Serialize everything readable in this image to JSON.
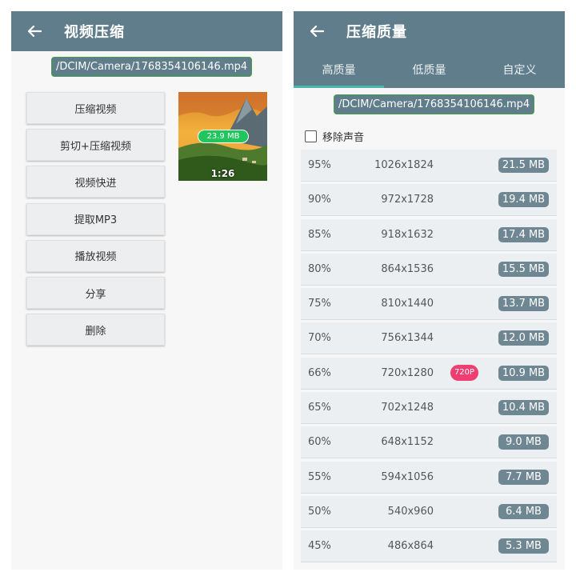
{
  "left": {
    "title": "视频压缩",
    "path": "/DCIM/Camera/1768354106146.mp4",
    "buttons": [
      "压缩视频",
      "剪切+压缩视频",
      "视频快进",
      "提取MP3",
      "播放视频",
      "分享",
      "删除"
    ],
    "thumbnail": {
      "size": "23.9 MB",
      "duration": "1:26"
    }
  },
  "right": {
    "title": "压缩质量",
    "tabs": [
      "高质量",
      "低质量",
      "自定义"
    ],
    "active_tab": 0,
    "path": "/DCIM/Camera/1768354106146.mp4",
    "remove_audio_label": "移除声音",
    "rows": [
      {
        "pct": "95%",
        "res": "1026x1824",
        "size": "21.5 MB"
      },
      {
        "pct": "90%",
        "res": "972x1728",
        "size": "19.4 MB"
      },
      {
        "pct": "85%",
        "res": "918x1632",
        "size": "17.4 MB"
      },
      {
        "pct": "80%",
        "res": "864x1536",
        "size": "15.5 MB"
      },
      {
        "pct": "75%",
        "res": "810x1440",
        "size": "13.7 MB"
      },
      {
        "pct": "70%",
        "res": "756x1344",
        "size": "12.0 MB"
      },
      {
        "pct": "66%",
        "res": "720x1280",
        "size": "10.9 MB",
        "tag": "720P"
      },
      {
        "pct": "65%",
        "res": "702x1248",
        "size": "10.4 MB"
      },
      {
        "pct": "60%",
        "res": "648x1152",
        "size": "9.0 MB"
      },
      {
        "pct": "55%",
        "res": "594x1056",
        "size": "7.7 MB"
      },
      {
        "pct": "50%",
        "res": "540x960",
        "size": "6.4 MB"
      },
      {
        "pct": "45%",
        "res": "486x864",
        "size": "5.3 MB"
      }
    ]
  },
  "colors": {
    "appbar": "#607d8b",
    "accent": "#4db6ac",
    "badge_green": "#21c55d",
    "tag_pink": "#f03e73"
  }
}
